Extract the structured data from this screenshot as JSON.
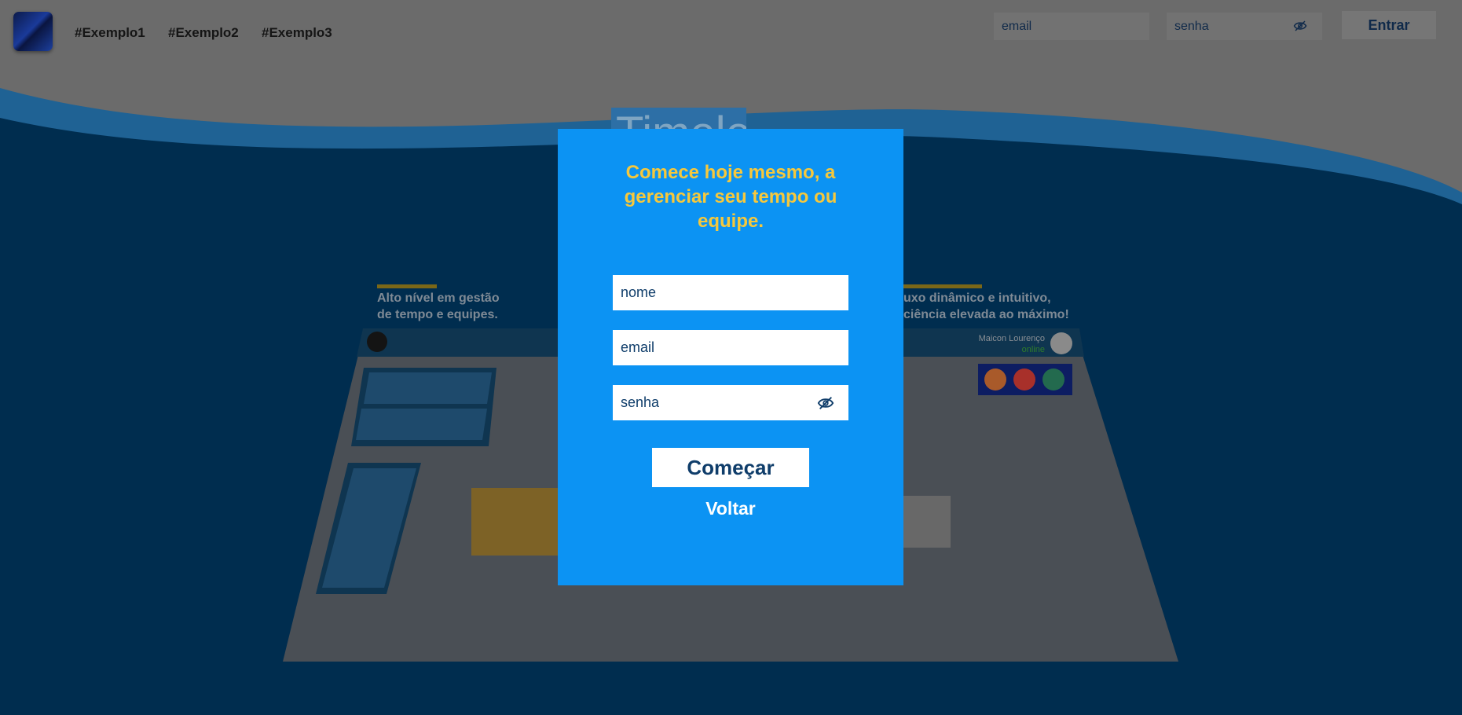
{
  "nav": {
    "links": [
      "#Exemplo1",
      "#Exemplo2",
      "#Exemplo3"
    ],
    "email_placeholder": "email",
    "password_placeholder": "senha",
    "login_label": "Entrar"
  },
  "brand": {
    "text": "Timeless"
  },
  "features": {
    "left": [
      "Alto nível em gestão",
      "de tempo e equipes."
    ],
    "right": [
      "uxo dinâmico e intuitivo,",
      "ciência elevada ao máximo!"
    ]
  },
  "preview": {
    "user_name": "Maicon Lourenço",
    "user_status": "online"
  },
  "modal": {
    "title": "Comece hoje mesmo, a gerenciar seu tempo ou equipe.",
    "name_placeholder": "nome",
    "email_placeholder": "email",
    "password_placeholder": "senha",
    "start_label": "Começar",
    "back_label": "Voltar"
  },
  "colors": {
    "modal_bg": "#0c93f3",
    "title": "#f6c83c",
    "text_dark": "#0f3d6a",
    "page_blue": "#002d4f"
  },
  "icons": {
    "password_toggle": "eye-slash-icon"
  }
}
